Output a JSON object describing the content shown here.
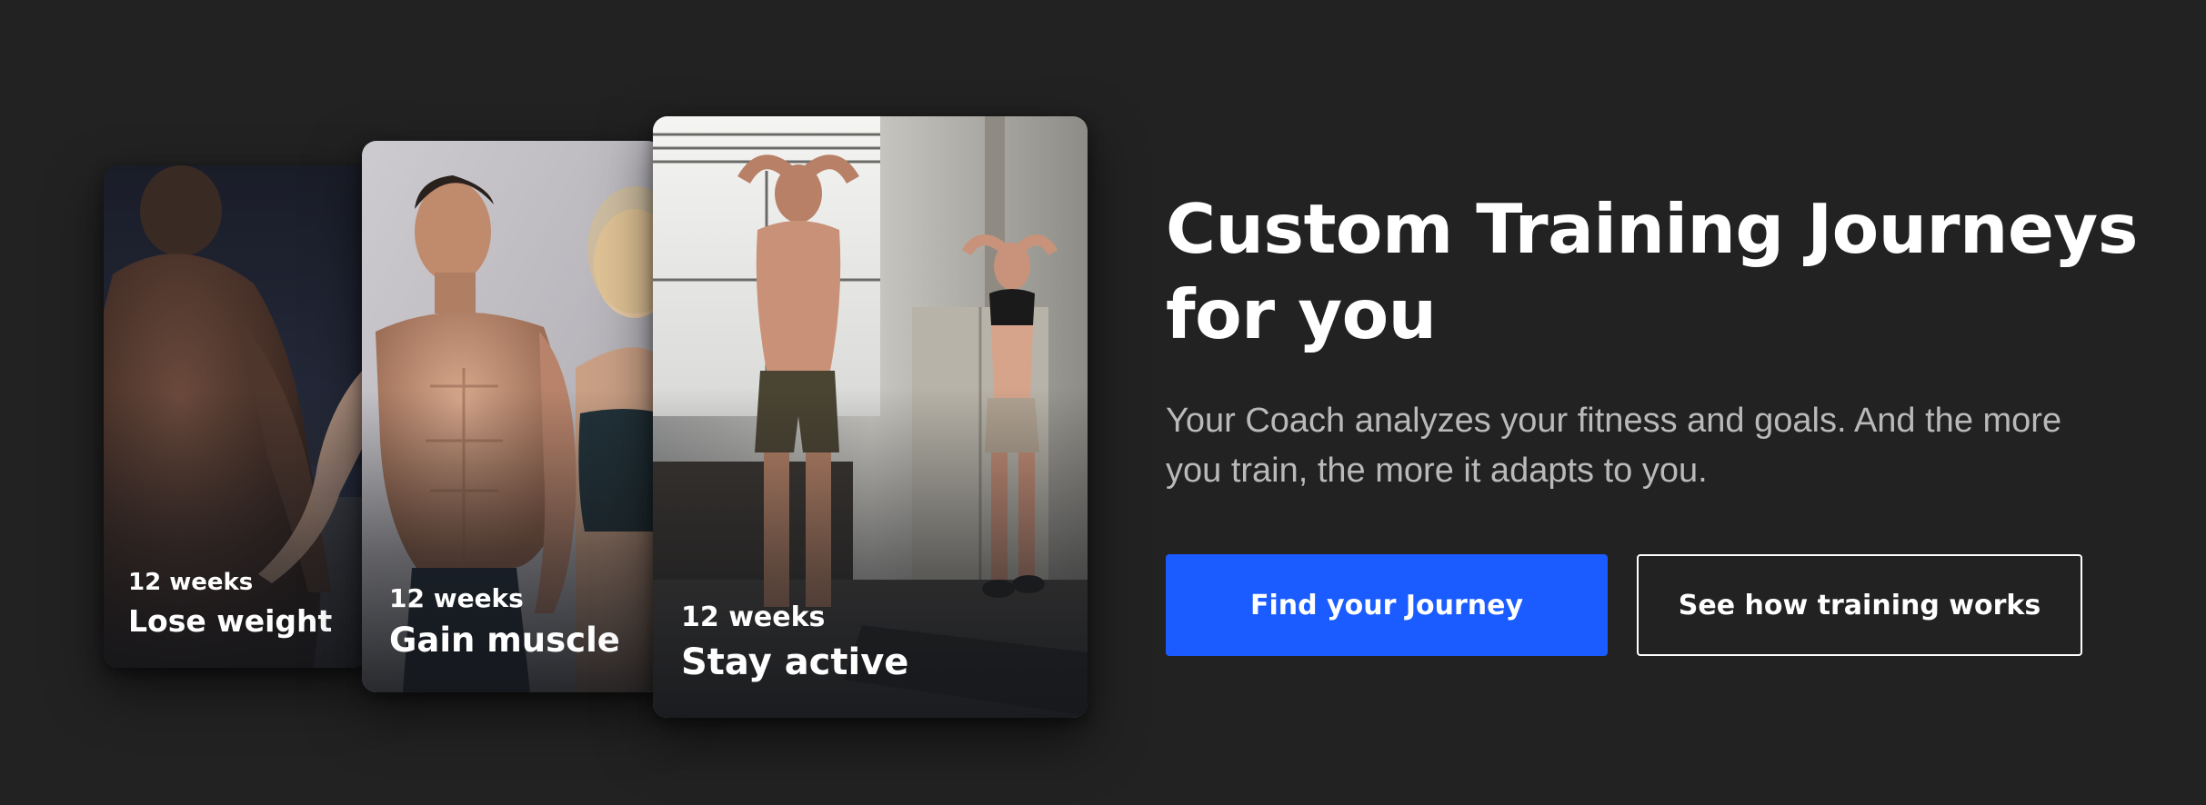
{
  "cards": [
    {
      "id": "lose",
      "weeks": "12 weeks",
      "goal": "Lose weight",
      "image": "athlete-back-gym-photo"
    },
    {
      "id": "gain",
      "weeks": "12 weeks",
      "goal": "Gain muscle",
      "image": "muscular-man-and-woman-photo"
    },
    {
      "id": "active",
      "weeks": "12 weeks",
      "goal": "Stay active",
      "image": "couple-stretching-loft-photo"
    }
  ],
  "hero": {
    "headline_line1": "Custom Training Journeys",
    "headline_line2": "for you",
    "subtitle": "Your Coach analyzes your fitness and goals. And the more you train, the more it adapts to you."
  },
  "actions": {
    "primary_label": "Find your Journey",
    "secondary_label": "See how training works"
  },
  "colors": {
    "background": "#222222",
    "primary_button": "#1a5cff",
    "headline": "#ffffff",
    "subtitle": "#b9b9b9"
  }
}
